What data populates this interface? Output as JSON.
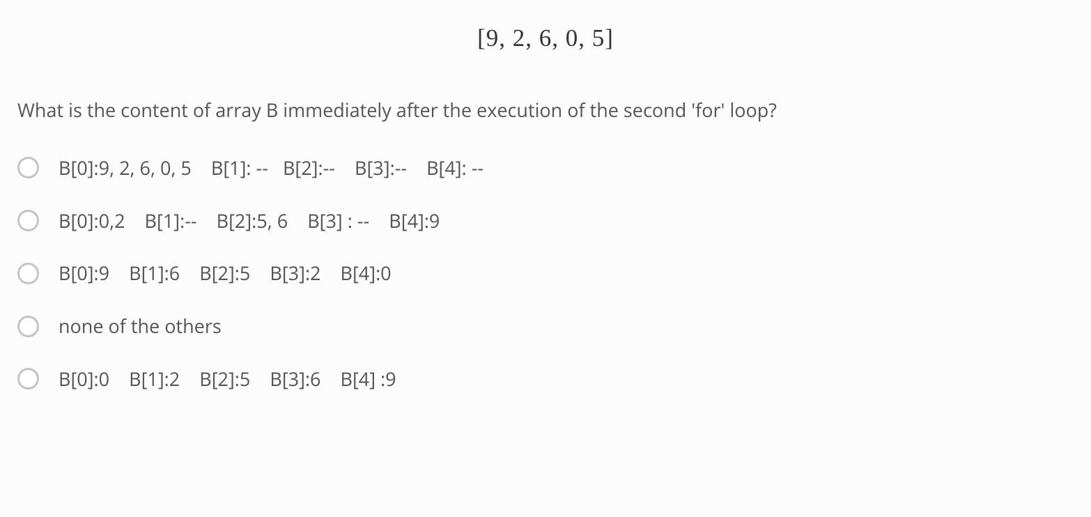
{
  "formula": "[9, 2, 6, 0, 5]",
  "question": "What is the content of array B immediately after the execution of the second 'for' loop?",
  "options": [
    "B[0]:9, 2, 6, 0, 5    B[1]: --   B[2]:--    B[3]:--    B[4]: --",
    "B[0]:0,2    B[1]:--    B[2]:5, 6    B[3] : --    B[4]:9",
    "B[0]:9    B[1]:6    B[2]:5    B[3]:2    B[4]:0",
    "none of the others",
    "B[0]:0    B[1]:2    B[2]:5    B[3]:6    B[4] :9"
  ]
}
